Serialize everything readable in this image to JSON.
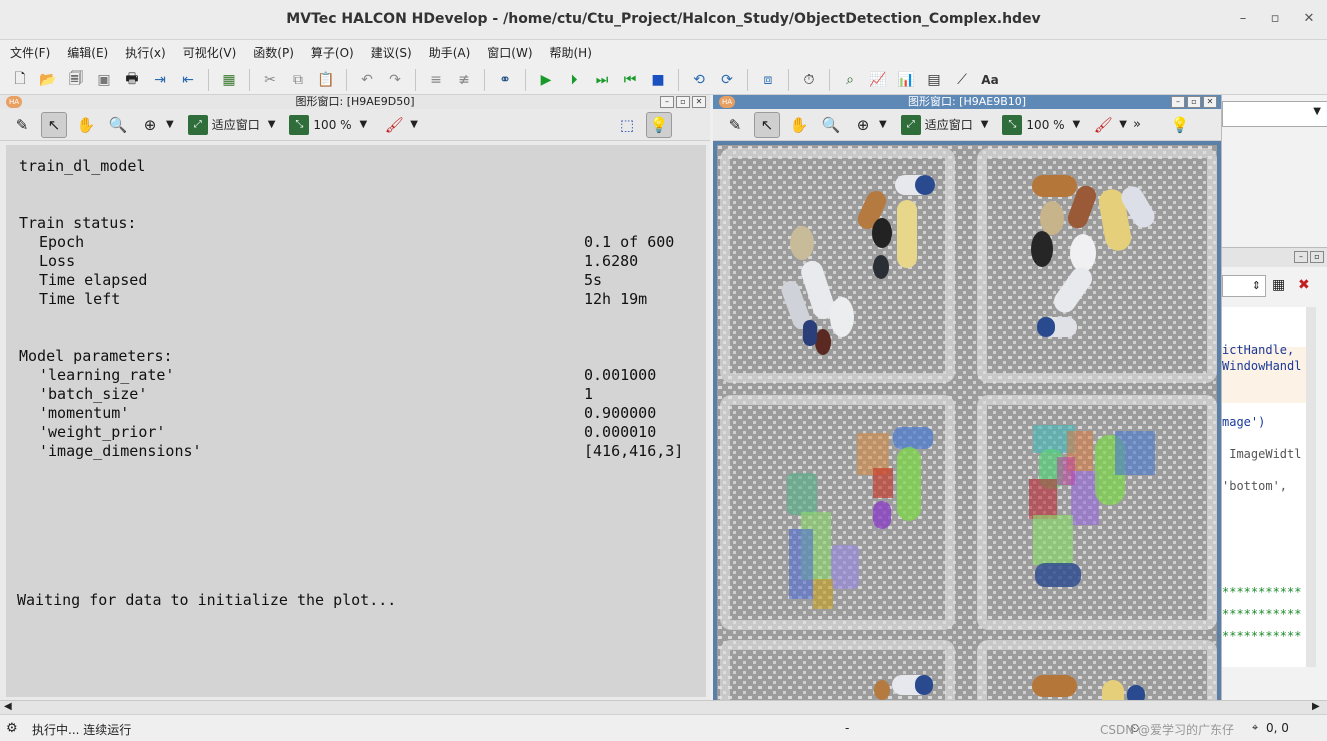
{
  "app": {
    "title": "MVTec HALCON HDevelop - /home/ctu/Ctu_Project/Halcon_Study/ObjectDetection_Complex.hdev"
  },
  "menu": [
    "文件(F)",
    "编辑(E)",
    "执行(x)",
    "可视化(V)",
    "函数(P)",
    "算子(O)",
    "建议(S)",
    "助手(A)",
    "窗口(W)",
    "帮助(H)"
  ],
  "graphics_left": {
    "title": "图形窗口: [H9AE9D50]",
    "fit_label": "适应窗口",
    "zoom_label": "100 %",
    "console": {
      "header": "train_dl_model",
      "train_status_title": "Train status:",
      "train_status": [
        {
          "label": "Epoch",
          "value": "0.1 of 600"
        },
        {
          "label": "Loss",
          "value": "1.6280"
        },
        {
          "label": "Time elapsed",
          "value": "5s"
        },
        {
          "label": "Time left",
          "value": "12h 19m"
        }
      ],
      "model_params_title": "Model parameters:",
      "model_params": [
        {
          "label": "'learning_rate'",
          "value": "0.001000"
        },
        {
          "label": "'batch_size'",
          "value": "1"
        },
        {
          "label": "'momentum'",
          "value": "0.900000"
        },
        {
          "label": "'weight_prior'",
          "value": "0.000010"
        },
        {
          "label": "'image_dimensions'",
          "value": "[416,416,3]"
        }
      ],
      "waiting": "Waiting for data to initialize the plot..."
    }
  },
  "graphics_right": {
    "title": "图形窗口: [H9AE9B10]",
    "fit_label": "适应窗口",
    "zoom_label": "100 %",
    "more": "»"
  },
  "editor": {
    "lines": [
      "ictHandle,",
      "WindowHandl",
      "mage')",
      " ImageWidtl",
      "'bottom',",
      "***********",
      "***********",
      "***********"
    ]
  },
  "status": {
    "running": "执行中... 连续运行",
    "dash": "-",
    "coords": "0, 0",
    "watermark": "CSDN @爱学习的广东仔"
  },
  "colors": {
    "accent_title_blue": "#5e88b6",
    "console_bg": "#d4d4d4"
  }
}
